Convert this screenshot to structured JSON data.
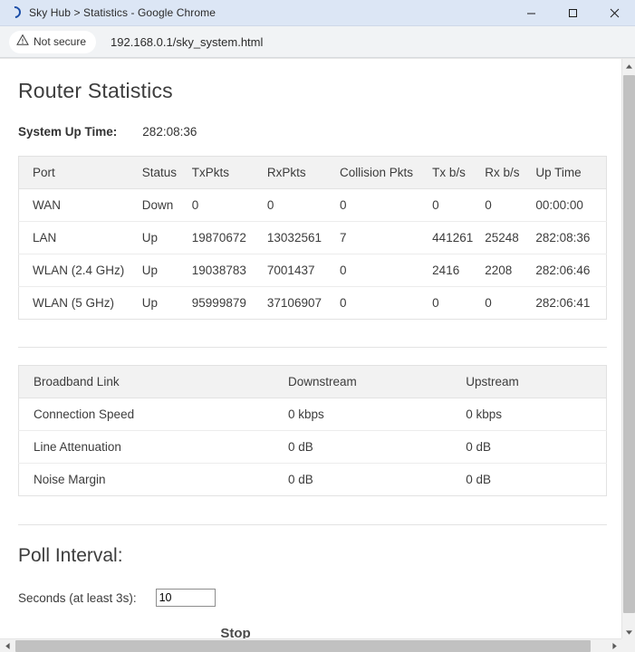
{
  "browser": {
    "window_title": "Sky Hub > Statistics - Google Chrome",
    "favicon": "sky-arc-icon",
    "minimize_label": "Minimize",
    "maximize_label": "Maximize",
    "close_label": "Close",
    "security_label": "Not secure",
    "security_icon": "warning-triangle-icon",
    "url": "192.168.0.1/sky_system.html"
  },
  "page": {
    "title": "Router Statistics",
    "uptime_label": "System Up Time:",
    "uptime_value": "282:08:36"
  },
  "stats_table": {
    "headers": [
      "Port",
      "Status",
      "TxPkts",
      "RxPkts",
      "Collision Pkts",
      "Tx b/s",
      "Rx b/s",
      "Up Time"
    ],
    "rows": [
      [
        "WAN",
        "Down",
        "0",
        "0",
        "0",
        "0",
        "0",
        "00:00:00"
      ],
      [
        "LAN",
        "Up",
        "19870672",
        "13032561",
        "7",
        "441261",
        "25248",
        "282:08:36"
      ],
      [
        "WLAN (2.4 GHz)",
        "Up",
        "19038783",
        "7001437",
        "0",
        "2416",
        "2208",
        "282:06:46"
      ],
      [
        "WLAN (5 GHz)",
        "Up",
        "95999879",
        "37106907",
        "0",
        "0",
        "0",
        "282:06:41"
      ]
    ]
  },
  "broadband_table": {
    "headers": [
      "Broadband Link",
      "Downstream",
      "Upstream"
    ],
    "rows": [
      [
        "Connection Speed",
        "0 kbps",
        "0 kbps"
      ],
      [
        "Line Attenuation",
        "0 dB",
        "0 dB"
      ],
      [
        "Noise Margin",
        "0 dB",
        "0 dB"
      ]
    ]
  },
  "poll": {
    "section_title": "Poll Interval:",
    "seconds_label": "Seconds (at least 3s):",
    "seconds_value": "10",
    "stop_label": "Stop"
  },
  "scrollbars": {
    "v_up_icon": "triangle-up-icon",
    "v_down_icon": "triangle-down-icon",
    "h_left_icon": "triangle-left-icon",
    "h_right_icon": "triangle-right-icon"
  }
}
